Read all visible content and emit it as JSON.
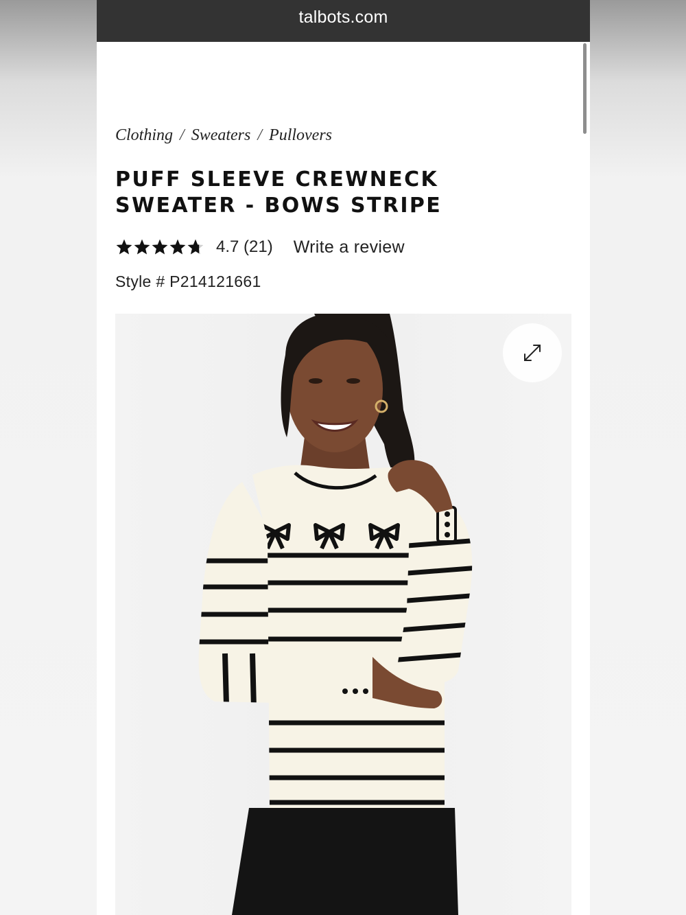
{
  "browser": {
    "url": "talbots.com"
  },
  "breadcrumb": {
    "items": [
      "Clothing",
      "Sweaters",
      "Pullovers"
    ],
    "separator": "/"
  },
  "product": {
    "title_line1": "PUFF SLEEVE CREWNECK",
    "title_line2": "SWEATER - BOWS STRIPE",
    "rating_value": 4.7,
    "rating_max": 5,
    "rating_text": "4.7 (21)",
    "write_review": "Write a review",
    "style_number": "Style # P214121661"
  },
  "icons": {
    "star": "star-icon",
    "zoom": "expand-icon"
  },
  "colors": {
    "url_bar": "#333333",
    "text": "#111111",
    "star": "#111111",
    "sweater": "#f7f3e6",
    "stripe": "#111111"
  }
}
